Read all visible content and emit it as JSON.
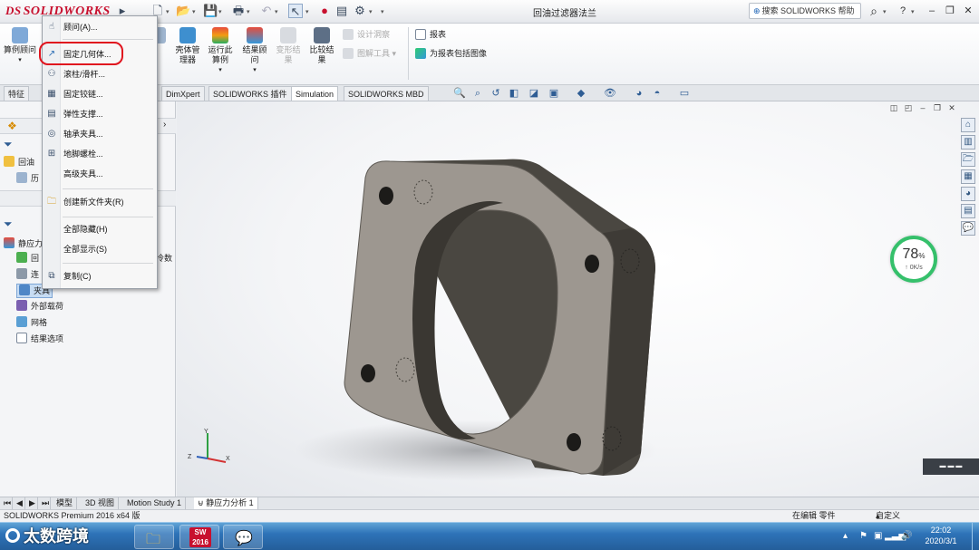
{
  "app": {
    "logo_text": "SOLIDWORKS",
    "logo_prefix": "DS",
    "document_title": "回油过滤器法兰",
    "help_search_placeholder": "搜索 SOLIDWORKS 帮助"
  },
  "command_manager": {
    "advisor_label": "算例顾问",
    "shell_manager_label": "壳体管理器",
    "run_study_label": "运行此算例",
    "results_advisor_label": "结果顾问",
    "deformed_result_label": "变形结果",
    "compare_results_label": "比较结果",
    "design_insight_label": "设计洞察",
    "plot_tools_label": "图解工具",
    "report_label": "报表",
    "include_image_label": "为报表包括图像"
  },
  "tabs": {
    "features": "特征",
    "dimxpert": "DimXpert",
    "addins": "SOLIDWORKS 插件",
    "simulation": "Simulation",
    "mbd": "SOLIDWORKS MBD"
  },
  "context_menu": {
    "items": [
      {
        "label": "顾问(A)...",
        "icon": "advisor-icon"
      },
      {
        "label": "固定几何体...",
        "icon": "fixed-geometry-icon"
      },
      {
        "label": "滚柱/滑杆...",
        "icon": "roller-slider-icon"
      },
      {
        "label": "固定铰链...",
        "icon": "fixed-hinge-icon"
      },
      {
        "label": "弹性支撑...",
        "icon": "elastic-support-icon"
      },
      {
        "label": "轴承夹具...",
        "icon": "bearing-fixture-icon"
      },
      {
        "label": "地脚螺栓...",
        "icon": "foundation-bolt-icon"
      },
      {
        "label": "高级夹具..."
      },
      {
        "label": "创建新文件夹(R)",
        "icon": "new-folder-icon"
      },
      {
        "label": "全部隐藏(H)"
      },
      {
        "label": "全部显示(S)"
      },
      {
        "label": "复制(C)",
        "icon": "copy-icon"
      }
    ]
  },
  "feature_tree": {
    "part_name": "回油",
    "history": "历",
    "study_name": "静应力",
    "study_suffix": "冷数",
    "part_item": "回",
    "connections": "连",
    "fixtures": "夹具",
    "external_loads": "外部载荷",
    "mesh": "网格",
    "result_options": "结果选项"
  },
  "viewport": {
    "gauge_percent": "78",
    "gauge_percent_unit": "%",
    "gauge_rate": "0K/s",
    "triad_x": "X",
    "triad_y": "Y",
    "triad_z": "Z"
  },
  "bottom_tabs": {
    "model": "模型",
    "view3d": "3D 视图",
    "motion": "Motion Study 1",
    "static_study": "静应力分析 1"
  },
  "status_bar": {
    "version": "SOLIDWORKS Premium 2016 x64 版",
    "editing": "在编辑 零件",
    "custom": "自定义"
  },
  "taskbar": {
    "watermark": "太数跨境",
    "sw_label": "2016",
    "time": "22:02",
    "date": "2020/3/1"
  },
  "colors": {
    "brand_red": "#c8102e",
    "highlight_ring": "#e0141e",
    "gauge_green": "#35c06b",
    "part_face": "#9d9790",
    "part_side": "#4a4741"
  }
}
